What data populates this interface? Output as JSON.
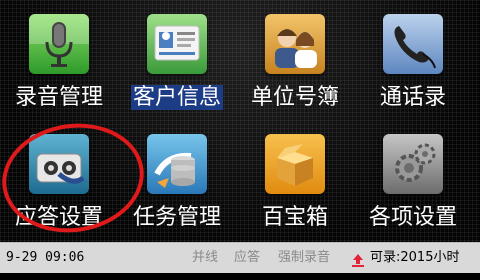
{
  "tiles": [
    {
      "label": "录音管理",
      "icon": "microphone-icon"
    },
    {
      "label": "客户信息",
      "icon": "contact-card-icon",
      "selected": true
    },
    {
      "label": "单位号簿",
      "icon": "people-icon"
    },
    {
      "label": "通话录",
      "icon": "phone-handset-icon"
    },
    {
      "label": "应答设置",
      "icon": "answering-machine-icon"
    },
    {
      "label": "任务管理",
      "icon": "task-database-icon"
    },
    {
      "label": "百宝箱",
      "icon": "treasure-box-icon"
    },
    {
      "label": "各项设置",
      "icon": "gears-icon"
    }
  ],
  "status": {
    "datetime": "9-29 09:06",
    "indicator_parallel": "并线",
    "indicator_answer": "应答",
    "indicator_force_record": "强制录音",
    "record_remaining": "可录:2015小时"
  },
  "colors": {
    "selection": "#1d3c86",
    "annotation_circle": "#e01a1a",
    "status_bar": "#d9d9d9"
  }
}
